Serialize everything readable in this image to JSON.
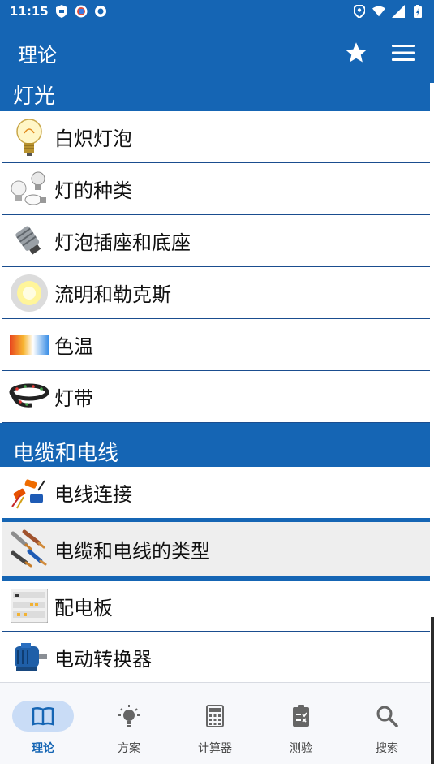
{
  "status_bar": {
    "time": "11:15",
    "left_icons": [
      "shield-icon",
      "app-badge-icon",
      "sync-icon"
    ],
    "right_icons": [
      "location-icon",
      "wifi-icon",
      "signal-icon",
      "battery-icon"
    ]
  },
  "app_bar": {
    "title": "理论",
    "actions": [
      "star-icon",
      "menu-icon"
    ]
  },
  "sections": [
    {
      "title": "灯光",
      "items": [
        {
          "label": "白炽灯泡",
          "icon": "incandescent-bulb-icon"
        },
        {
          "label": "灯的种类",
          "icon": "lamp-types-icon"
        },
        {
          "label": "灯泡插座和底座",
          "icon": "bulb-socket-icon"
        },
        {
          "label": "流明和勒克斯",
          "icon": "glowing-light-icon"
        },
        {
          "label": "色温",
          "icon": "color-temperature-icon"
        },
        {
          "label": "灯带",
          "icon": "led-strip-icon"
        }
      ]
    },
    {
      "title": "电缆和电线",
      "items": [
        {
          "label": "电线连接",
          "icon": "wire-connectors-icon"
        },
        {
          "label": "电缆和电线的类型",
          "icon": "cable-types-icon",
          "selected": true
        },
        {
          "label": "配电板",
          "icon": "distribution-board-icon"
        },
        {
          "label": "电动转换器",
          "icon": "electric-motor-icon"
        }
      ]
    }
  ],
  "bottom_nav": [
    {
      "label": "理论",
      "icon": "book-icon",
      "active": true
    },
    {
      "label": "方案",
      "icon": "lightbulb-icon"
    },
    {
      "label": "计算器",
      "icon": "calculator-icon"
    },
    {
      "label": "测验",
      "icon": "clipboard-icon"
    },
    {
      "label": "搜索",
      "icon": "search-icon"
    }
  ],
  "colors": {
    "primary": "#1565b4",
    "nav_active_pill": "#c9dcf6",
    "selected_row": "#eeeeee"
  }
}
